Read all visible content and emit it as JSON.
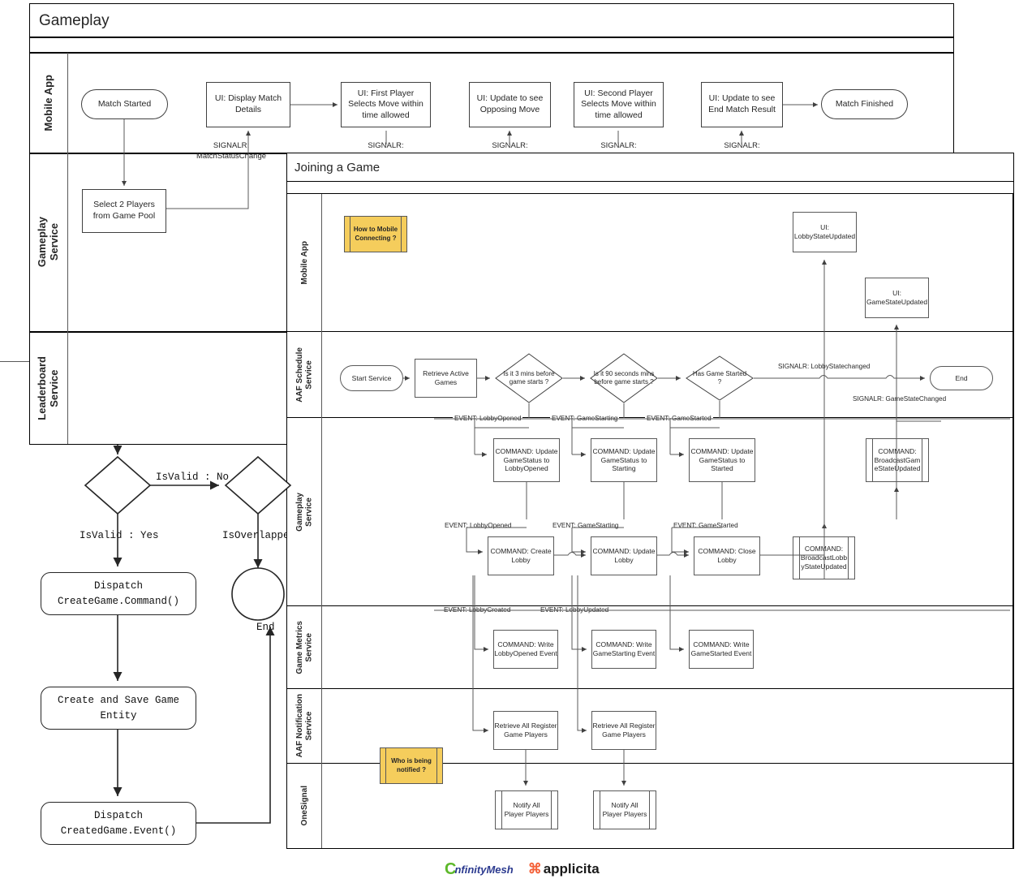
{
  "gameplay_panel": {
    "title": "Gameplay",
    "lanes": [
      "Mobile App",
      "Gameplay\nService",
      "Leaderboard\nService"
    ],
    "mobile_app_nodes": [
      {
        "id": "match-started",
        "label": "Match Started",
        "shape": "rounded"
      },
      {
        "id": "display-match-details",
        "label": "UI: Display Match Details",
        "shape": "rect"
      },
      {
        "id": "first-player-selects",
        "label": "UI: First Player Selects Move within time allowed",
        "shape": "rect"
      },
      {
        "id": "update-opposing-move",
        "label": "UI: Update to see Opposing Move",
        "shape": "rect"
      },
      {
        "id": "second-player-selects",
        "label": "UI: Second Player Selects Move within time allowed",
        "shape": "rect"
      },
      {
        "id": "update-end-match",
        "label": "UI: Update to see End Match Result",
        "shape": "rect"
      },
      {
        "id": "match-finished",
        "label": "Match Finished",
        "shape": "rounded"
      }
    ],
    "gameplay_nodes": [
      {
        "id": "select-2-players",
        "label": "Select 2 Players from Game Pool",
        "shape": "rect"
      }
    ],
    "signalr_labels": [
      {
        "id": "signalr-match-status",
        "line1": "SIGNALR:",
        "line2": "MatchStatusChange"
      },
      {
        "id": "signalr-2",
        "line1": "SIGNALR:",
        "line2": ""
      },
      {
        "id": "signalr-3",
        "line1": "SIGNALR:",
        "line2": ""
      },
      {
        "id": "signalr-4",
        "line1": "SIGNALR:",
        "line2": ""
      },
      {
        "id": "signalr-5",
        "line1": "SIGNALR:",
        "line2": ""
      }
    ]
  },
  "create_game_flow": {
    "decision_1_label": "",
    "decision_2_label": "",
    "edge_isvalid_no": "IsValid : No",
    "edge_isvalid_yes": "IsValid : Yes",
    "edge_isoverlapped": "IsOverlapped",
    "end_label": "End",
    "nodes": [
      {
        "id": "dispatch-create-game-command",
        "label": "Dispatch\nCreateGame.Command()"
      },
      {
        "id": "create-and-save-game-entity",
        "label": "Create and Save Game\nEntity"
      },
      {
        "id": "dispatch-created-game-event",
        "label": "Dispatch\nCreatedGame.Event()"
      }
    ]
  },
  "joining_panel": {
    "title": "Joining a Game",
    "lanes": [
      "Mobile App",
      "AAF Schedule\nService",
      "Gameplay\nService",
      "Game Metrics\nService",
      "AAF Notification\nService",
      "OneSignal"
    ],
    "mobile_app": {
      "note": "How to Mobile\nConnecting ?",
      "nodes": [
        {
          "id": "ui-lobby-state-updated",
          "label": "UI:\nLobbyStateUpdated"
        },
        {
          "id": "ui-game-state-updated",
          "label": "UI:\nGameStateUpdated"
        }
      ]
    },
    "aaf_schedule": {
      "start": "Start Service",
      "retrieve": "Retrieve Active\nGames",
      "decisions": [
        {
          "id": "is-3-mins-before",
          "label": "Is it 3 mins before game starts ?"
        },
        {
          "id": "is-90-seconds-before",
          "label": "Is it 90 seconds mins before game starts ?"
        },
        {
          "id": "has-game-started",
          "label": "Has Game Started ?"
        }
      ],
      "end": "End",
      "signalr_lobby": "SIGNALR: LobbyStatechanged",
      "signalr_game": "SIGNALR: GameStateChanged"
    },
    "event_labels_row1": [
      "EVENT: LobbyOpened",
      "EVENT: GameStarting",
      "EVENT: GameStarted"
    ],
    "event_labels_row2": [
      "EVENT: LobbyOpened",
      "EVENT: GameStarting",
      "EVENT: GameStarted"
    ],
    "event_labels_row3": [
      "EVENT: LobbyCreated",
      "EVENT: LobbyUpdated"
    ],
    "gameplay_row1": [
      {
        "id": "cmd-update-lobbyopened",
        "label": "COMMAND: Update\nGameStatus to\nLobbyOpened"
      },
      {
        "id": "cmd-update-starting",
        "label": "COMMAND: Update\nGameStatus to\nStarting"
      },
      {
        "id": "cmd-update-started",
        "label": "COMMAND: Update\nGameStatus to\nStarted"
      },
      {
        "id": "cmd-broadcast-gamestate",
        "label": "COMMAND:\nBroadcastGam\neStateUpdated",
        "sub": true
      }
    ],
    "gameplay_row2": [
      {
        "id": "cmd-create-lobby",
        "label": "COMMAND: Create\nLobby"
      },
      {
        "id": "cmd-update-lobby",
        "label": "COMMAND: Update\nLobby"
      },
      {
        "id": "cmd-close-lobby",
        "label": "COMMAND: Close\nLobby"
      },
      {
        "id": "cmd-broadcast-lobbystate",
        "label": "COMMAND:\nBroadcastLobb\nyStateUpdated",
        "sub": true
      }
    ],
    "game_metrics": [
      {
        "id": "cmd-write-lobbyopened",
        "label": "COMMAND: Write\nLobbyOpened Event"
      },
      {
        "id": "cmd-write-gamestarting",
        "label": "COMMAND: Write\nGameStarting Event"
      },
      {
        "id": "cmd-write-gamestarted",
        "label": "COMMAND: Write\nGameStarted Event"
      }
    ],
    "aaf_notification": {
      "note": "Who is being\nnotified ?",
      "nodes": [
        {
          "id": "retrieve-registered-1",
          "label": "Retrieve All Register\nGame Players"
        },
        {
          "id": "retrieve-registered-2",
          "label": "Retrieve All Register\nGame Players"
        }
      ]
    },
    "onesignal": [
      {
        "id": "notify-all-1",
        "label": "Notify All\nPlayer Players",
        "sub": true
      },
      {
        "id": "notify-all-2",
        "label": "Notify All\nPlayer Players",
        "sub": true
      }
    ]
  },
  "footer": {
    "logo1_mark": "C",
    "logo1_part1": "nfinity",
    "logo1_part2": "Mesh",
    "logo2_mark": "⌘",
    "logo2_text": "applicita",
    "logo1_color": "#5db82a",
    "logo1_text_color": "#2b3a8f",
    "logo2_color": "#f4623a",
    "logo2_text_color": "#1a1a1a"
  },
  "colors": {
    "note_fill": "#f5cd5c",
    "stroke": "#595959",
    "frame": "#000000"
  }
}
